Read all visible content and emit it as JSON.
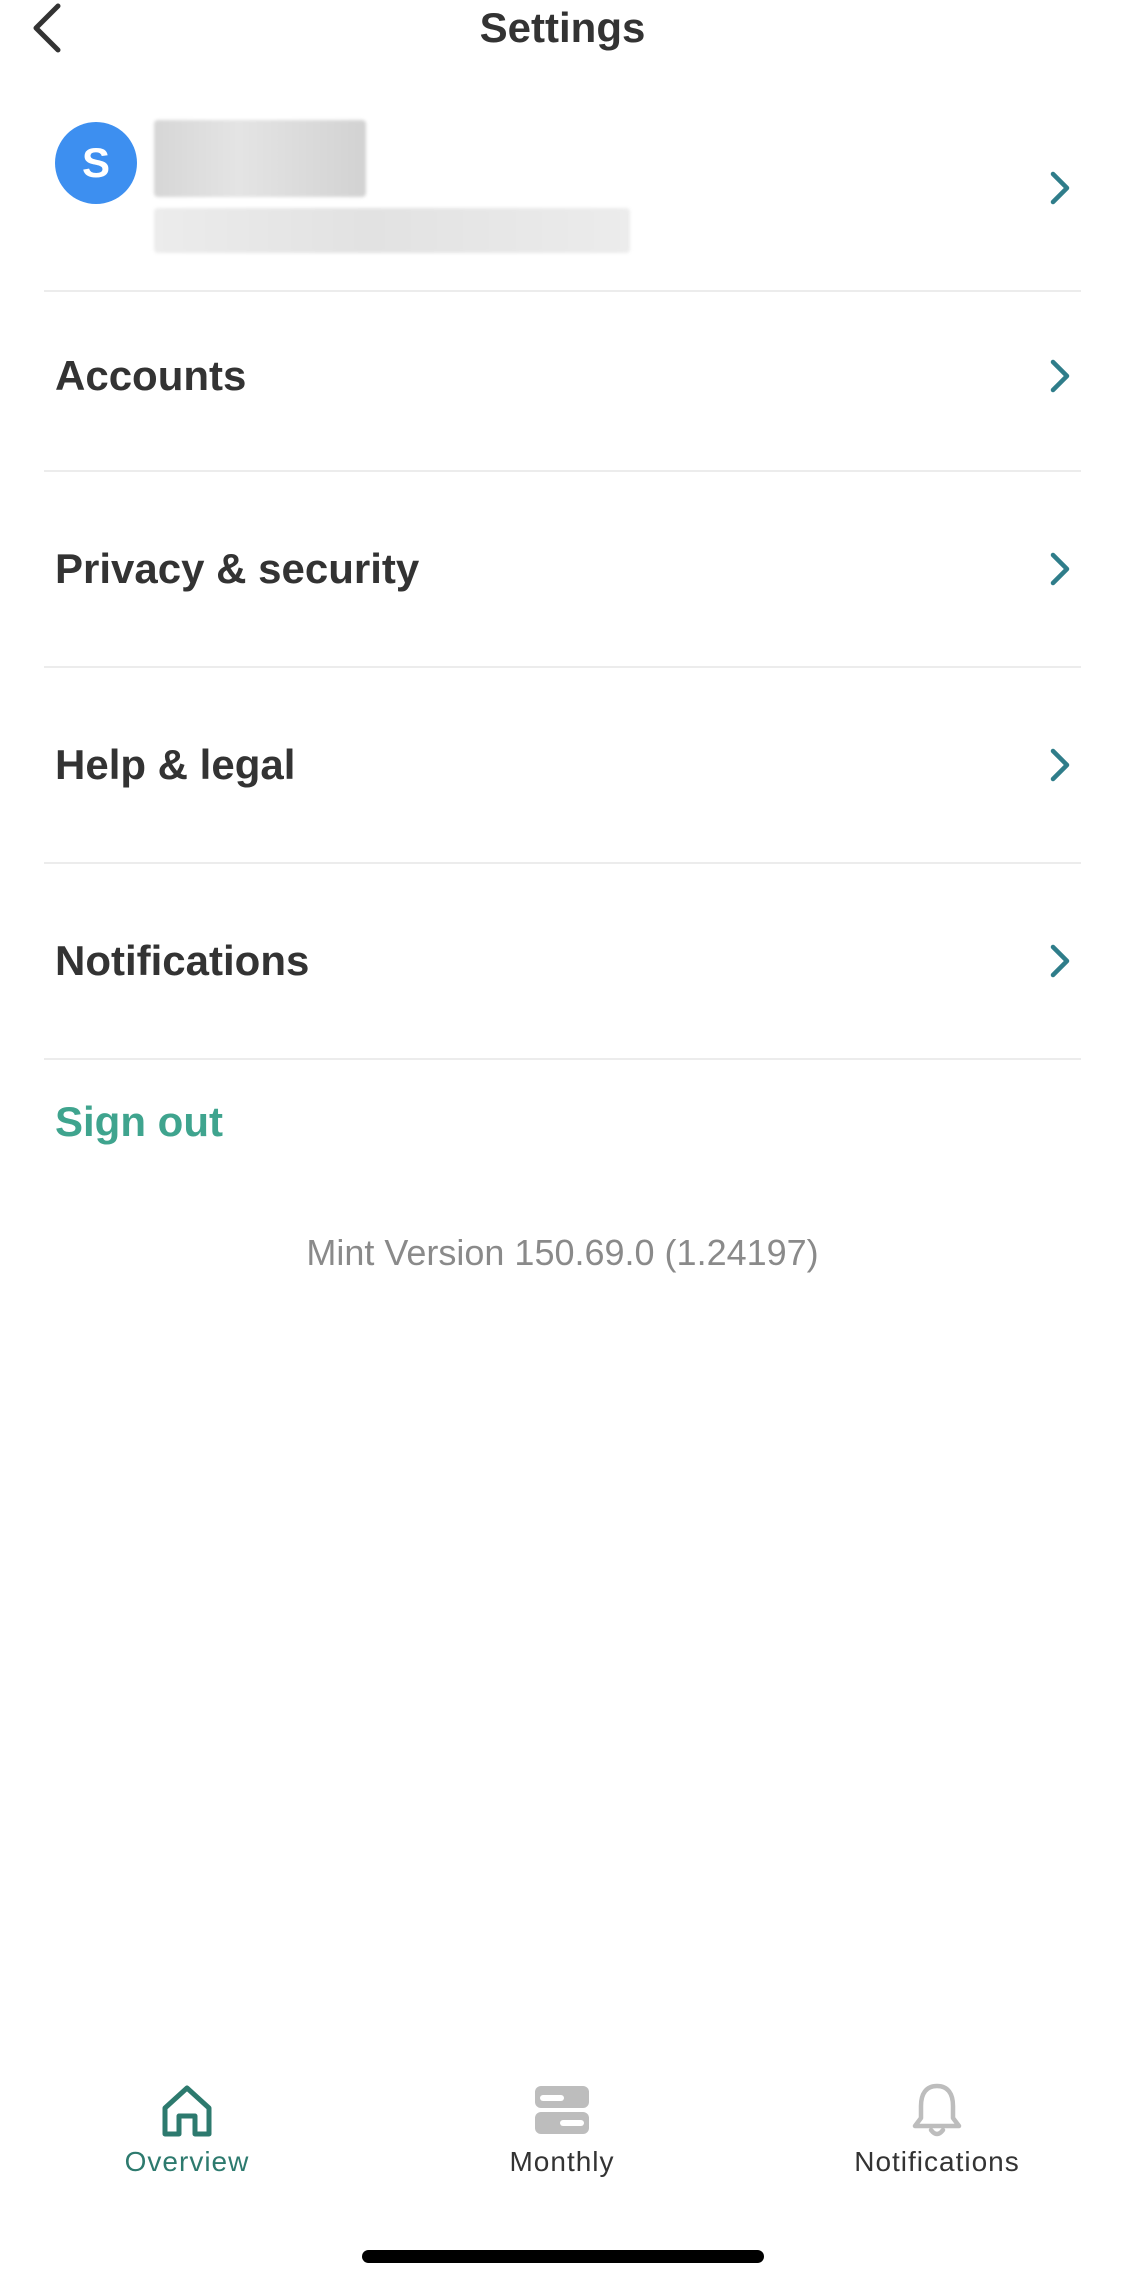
{
  "header": {
    "title": "Settings"
  },
  "profile": {
    "avatar_letter": "S"
  },
  "menu": {
    "items": [
      {
        "label": "Accounts"
      },
      {
        "label": "Privacy & security"
      },
      {
        "label": "Help & legal"
      },
      {
        "label": "Notifications"
      }
    ]
  },
  "sign_out_label": "Sign out",
  "version_text": "Mint Version 150.69.0 (1.24197)",
  "tabs": [
    {
      "label": "Overview",
      "icon": "home-icon",
      "active": true
    },
    {
      "label": "Monthly",
      "icon": "monthly-icon",
      "active": false
    },
    {
      "label": "Notifications",
      "icon": "bell-icon",
      "active": false
    }
  ],
  "colors": {
    "accent": "#3fa48e",
    "chevron": "#2f7d8a",
    "avatar": "#3d8ff0",
    "active_tab": "#2d7a6e",
    "inactive_icon": "#bdbdbd"
  }
}
